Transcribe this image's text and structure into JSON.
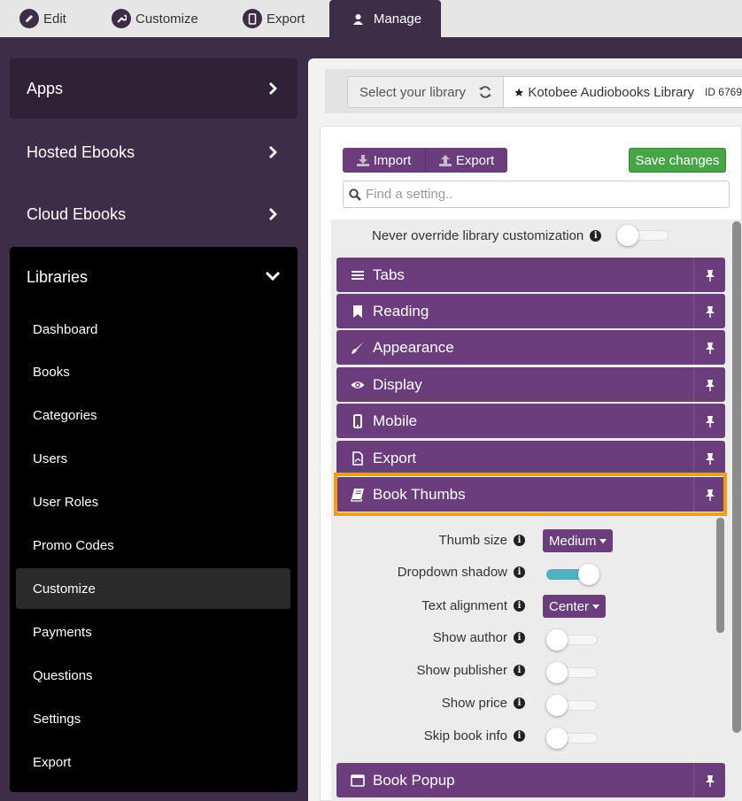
{
  "topbar": {
    "tabs": [
      {
        "label": "Edit",
        "icon": "pencil-icon"
      },
      {
        "label": "Customize",
        "icon": "wrench-icon"
      },
      {
        "label": "Export",
        "icon": "mobile-icon"
      },
      {
        "label": "Manage",
        "icon": "user-icon",
        "active": true
      }
    ]
  },
  "sidebar": {
    "items": [
      {
        "label": "Apps"
      },
      {
        "label": "Hosted Ebooks"
      },
      {
        "label": "Cloud Ebooks"
      }
    ],
    "libraries": {
      "label": "Libraries",
      "sub_items": [
        {
          "label": "Dashboard"
        },
        {
          "label": "Books"
        },
        {
          "label": "Categories"
        },
        {
          "label": "Users"
        },
        {
          "label": "User Roles"
        },
        {
          "label": "Promo Codes"
        },
        {
          "label": "Customize",
          "active": true
        },
        {
          "label": "Payments"
        },
        {
          "label": "Questions"
        },
        {
          "label": "Settings"
        },
        {
          "label": "Export"
        }
      ]
    }
  },
  "library_bar": {
    "select_label": "Select your library",
    "library_name": "Kotobee Audiobooks Library",
    "library_id": "ID 6769"
  },
  "toolbar": {
    "import_label": "Import",
    "export_label": "Export",
    "save_label": "Save changes",
    "search_placeholder": "Find a setting.."
  },
  "override": {
    "label": "Never override library customization",
    "value": false
  },
  "sections": [
    {
      "label": "Tabs",
      "icon": "list-icon"
    },
    {
      "label": "Reading",
      "icon": "bookmark-icon"
    },
    {
      "label": "Appearance",
      "icon": "brush-icon"
    },
    {
      "label": "Display",
      "icon": "eye-icon"
    },
    {
      "label": "Mobile",
      "icon": "mobile-icon"
    },
    {
      "label": "Export",
      "icon": "pdf-file-icon"
    },
    {
      "label": "Book Thumbs",
      "icon": "book-icon",
      "expanded": true
    }
  ],
  "book_thumbs": {
    "thumb_size": {
      "label": "Thumb size",
      "value": "Medium"
    },
    "dropdown_shadow": {
      "label": "Dropdown shadow",
      "value": true
    },
    "text_alignment": {
      "label": "Text alignment",
      "value": "Center"
    },
    "show_author": {
      "label": "Show author",
      "value": false
    },
    "show_publisher": {
      "label": "Show publisher",
      "value": false
    },
    "show_price": {
      "label": "Show price",
      "value": false
    },
    "skip_book_info": {
      "label": "Skip book info",
      "value": false
    }
  },
  "next_section": {
    "label": "Book Popup",
    "icon": "window-icon"
  },
  "colors": {
    "purple": "#6b3d7d",
    "dark_bg": "#3d2d46",
    "save_green": "#47a447",
    "highlight": "#f5a000",
    "toggle_on": "#4fb3bf"
  }
}
